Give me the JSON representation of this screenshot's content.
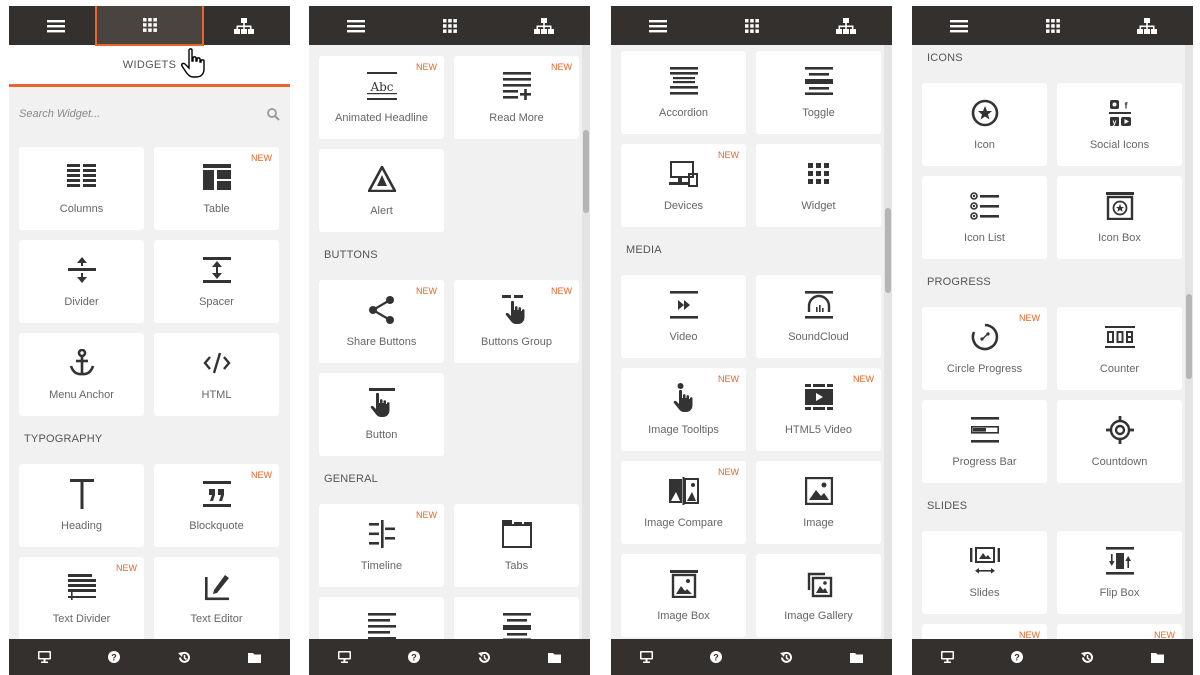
{
  "colors": {
    "bar": "#34302e",
    "accent": "#e8652b",
    "panel_bg": "#f1f1f1",
    "card_bg": "#ffffff"
  },
  "panels": [
    {
      "tab_title": "WIDGETS",
      "search_placeholder": "Search Widget...",
      "sections": [
        "TYPOGRAPHY"
      ],
      "widgets": [
        {
          "label": "Columns",
          "icon": "columns-icon",
          "new": ""
        },
        {
          "label": "Table",
          "icon": "table-icon",
          "new": "NEW"
        },
        {
          "label": "Divider",
          "icon": "divider-icon",
          "new": ""
        },
        {
          "label": "Spacer",
          "icon": "spacer-icon",
          "new": ""
        },
        {
          "label": "Menu Anchor",
          "icon": "anchor-icon",
          "new": ""
        },
        {
          "label": "HTML",
          "icon": "html-icon",
          "new": ""
        },
        {
          "label": "Heading",
          "icon": "heading-icon",
          "new": ""
        },
        {
          "label": "Blockquote",
          "icon": "blockquote-icon",
          "new": "NEW"
        },
        {
          "label": "Text Divider",
          "icon": "text-divider-icon",
          "new": "NEW"
        },
        {
          "label": "Text Editor",
          "icon": "text-editor-icon",
          "new": ""
        }
      ]
    },
    {
      "sections": [
        "BUTTONS",
        "GENERAL"
      ],
      "widgets": [
        {
          "label": "Animated Headline",
          "icon": "animated-headline-icon",
          "new": "NEW"
        },
        {
          "label": "Read More",
          "icon": "read-more-icon",
          "new": "NEW"
        },
        {
          "label": "Alert",
          "icon": "alert-icon",
          "new": ""
        },
        {
          "label": "Share Buttons",
          "icon": "share-icon",
          "new": "NEW"
        },
        {
          "label": "Buttons Group",
          "icon": "buttons-group-icon",
          "new": "NEW"
        },
        {
          "label": "Button",
          "icon": "button-icon",
          "new": ""
        },
        {
          "label": "Timeline",
          "icon": "timeline-icon",
          "new": "NEW"
        },
        {
          "label": "Tabs",
          "icon": "tabs-icon",
          "new": ""
        },
        {
          "label": "",
          "icon": "list-icon",
          "new": ""
        },
        {
          "label": "",
          "icon": "toggle-icon",
          "new": ""
        }
      ]
    },
    {
      "sections": [
        "MEDIA"
      ],
      "widgets": [
        {
          "label": "Accordion",
          "icon": "accordion-icon",
          "new": ""
        },
        {
          "label": "Toggle",
          "icon": "toggle-icon",
          "new": ""
        },
        {
          "label": "Devices",
          "icon": "devices-icon",
          "new": "NEW"
        },
        {
          "label": "Widget",
          "icon": "widget-icon",
          "new": ""
        },
        {
          "label": "Video",
          "icon": "video-icon",
          "new": ""
        },
        {
          "label": "SoundCloud",
          "icon": "soundcloud-icon",
          "new": ""
        },
        {
          "label": "Image Tooltips",
          "icon": "image-tooltips-icon",
          "new": "NEW"
        },
        {
          "label": "HTML5 Video",
          "icon": "html5-video-icon",
          "new": "NEW"
        },
        {
          "label": "Image Compare",
          "icon": "image-compare-icon",
          "new": "NEW"
        },
        {
          "label": "Image",
          "icon": "image-icon",
          "new": ""
        },
        {
          "label": "Image Box",
          "icon": "image-box-icon",
          "new": ""
        },
        {
          "label": "Image Gallery",
          "icon": "image-gallery-icon",
          "new": ""
        }
      ]
    },
    {
      "sections": [
        "ICONS",
        "PROGRESS",
        "SLIDES"
      ],
      "widgets": [
        {
          "label": "Icon",
          "icon": "star-circle-icon",
          "new": ""
        },
        {
          "label": "Social Icons",
          "icon": "social-icons-icon",
          "new": ""
        },
        {
          "label": "Icon List",
          "icon": "icon-list-icon",
          "new": ""
        },
        {
          "label": "Icon Box",
          "icon": "icon-box-icon",
          "new": ""
        },
        {
          "label": "Circle Progress",
          "icon": "circle-progress-icon",
          "new": "NEW"
        },
        {
          "label": "Counter",
          "icon": "counter-icon",
          "new": ""
        },
        {
          "label": "Progress Bar",
          "icon": "progress-bar-icon",
          "new": ""
        },
        {
          "label": "Countdown",
          "icon": "countdown-icon",
          "new": ""
        },
        {
          "label": "Slides",
          "icon": "slides-icon",
          "new": ""
        },
        {
          "label": "Flip Box",
          "icon": "flip-box-icon",
          "new": ""
        },
        {
          "label": "",
          "icon": "widget-icon",
          "new": "NEW"
        },
        {
          "label": "",
          "icon": "widget-icon",
          "new": "NEW"
        }
      ]
    }
  ],
  "topbar": [
    "menu-icon",
    "grid-icon",
    "sitemap-icon"
  ],
  "bottombar": [
    "desktop-icon",
    "help-icon",
    "history-icon",
    "folder-icon"
  ]
}
